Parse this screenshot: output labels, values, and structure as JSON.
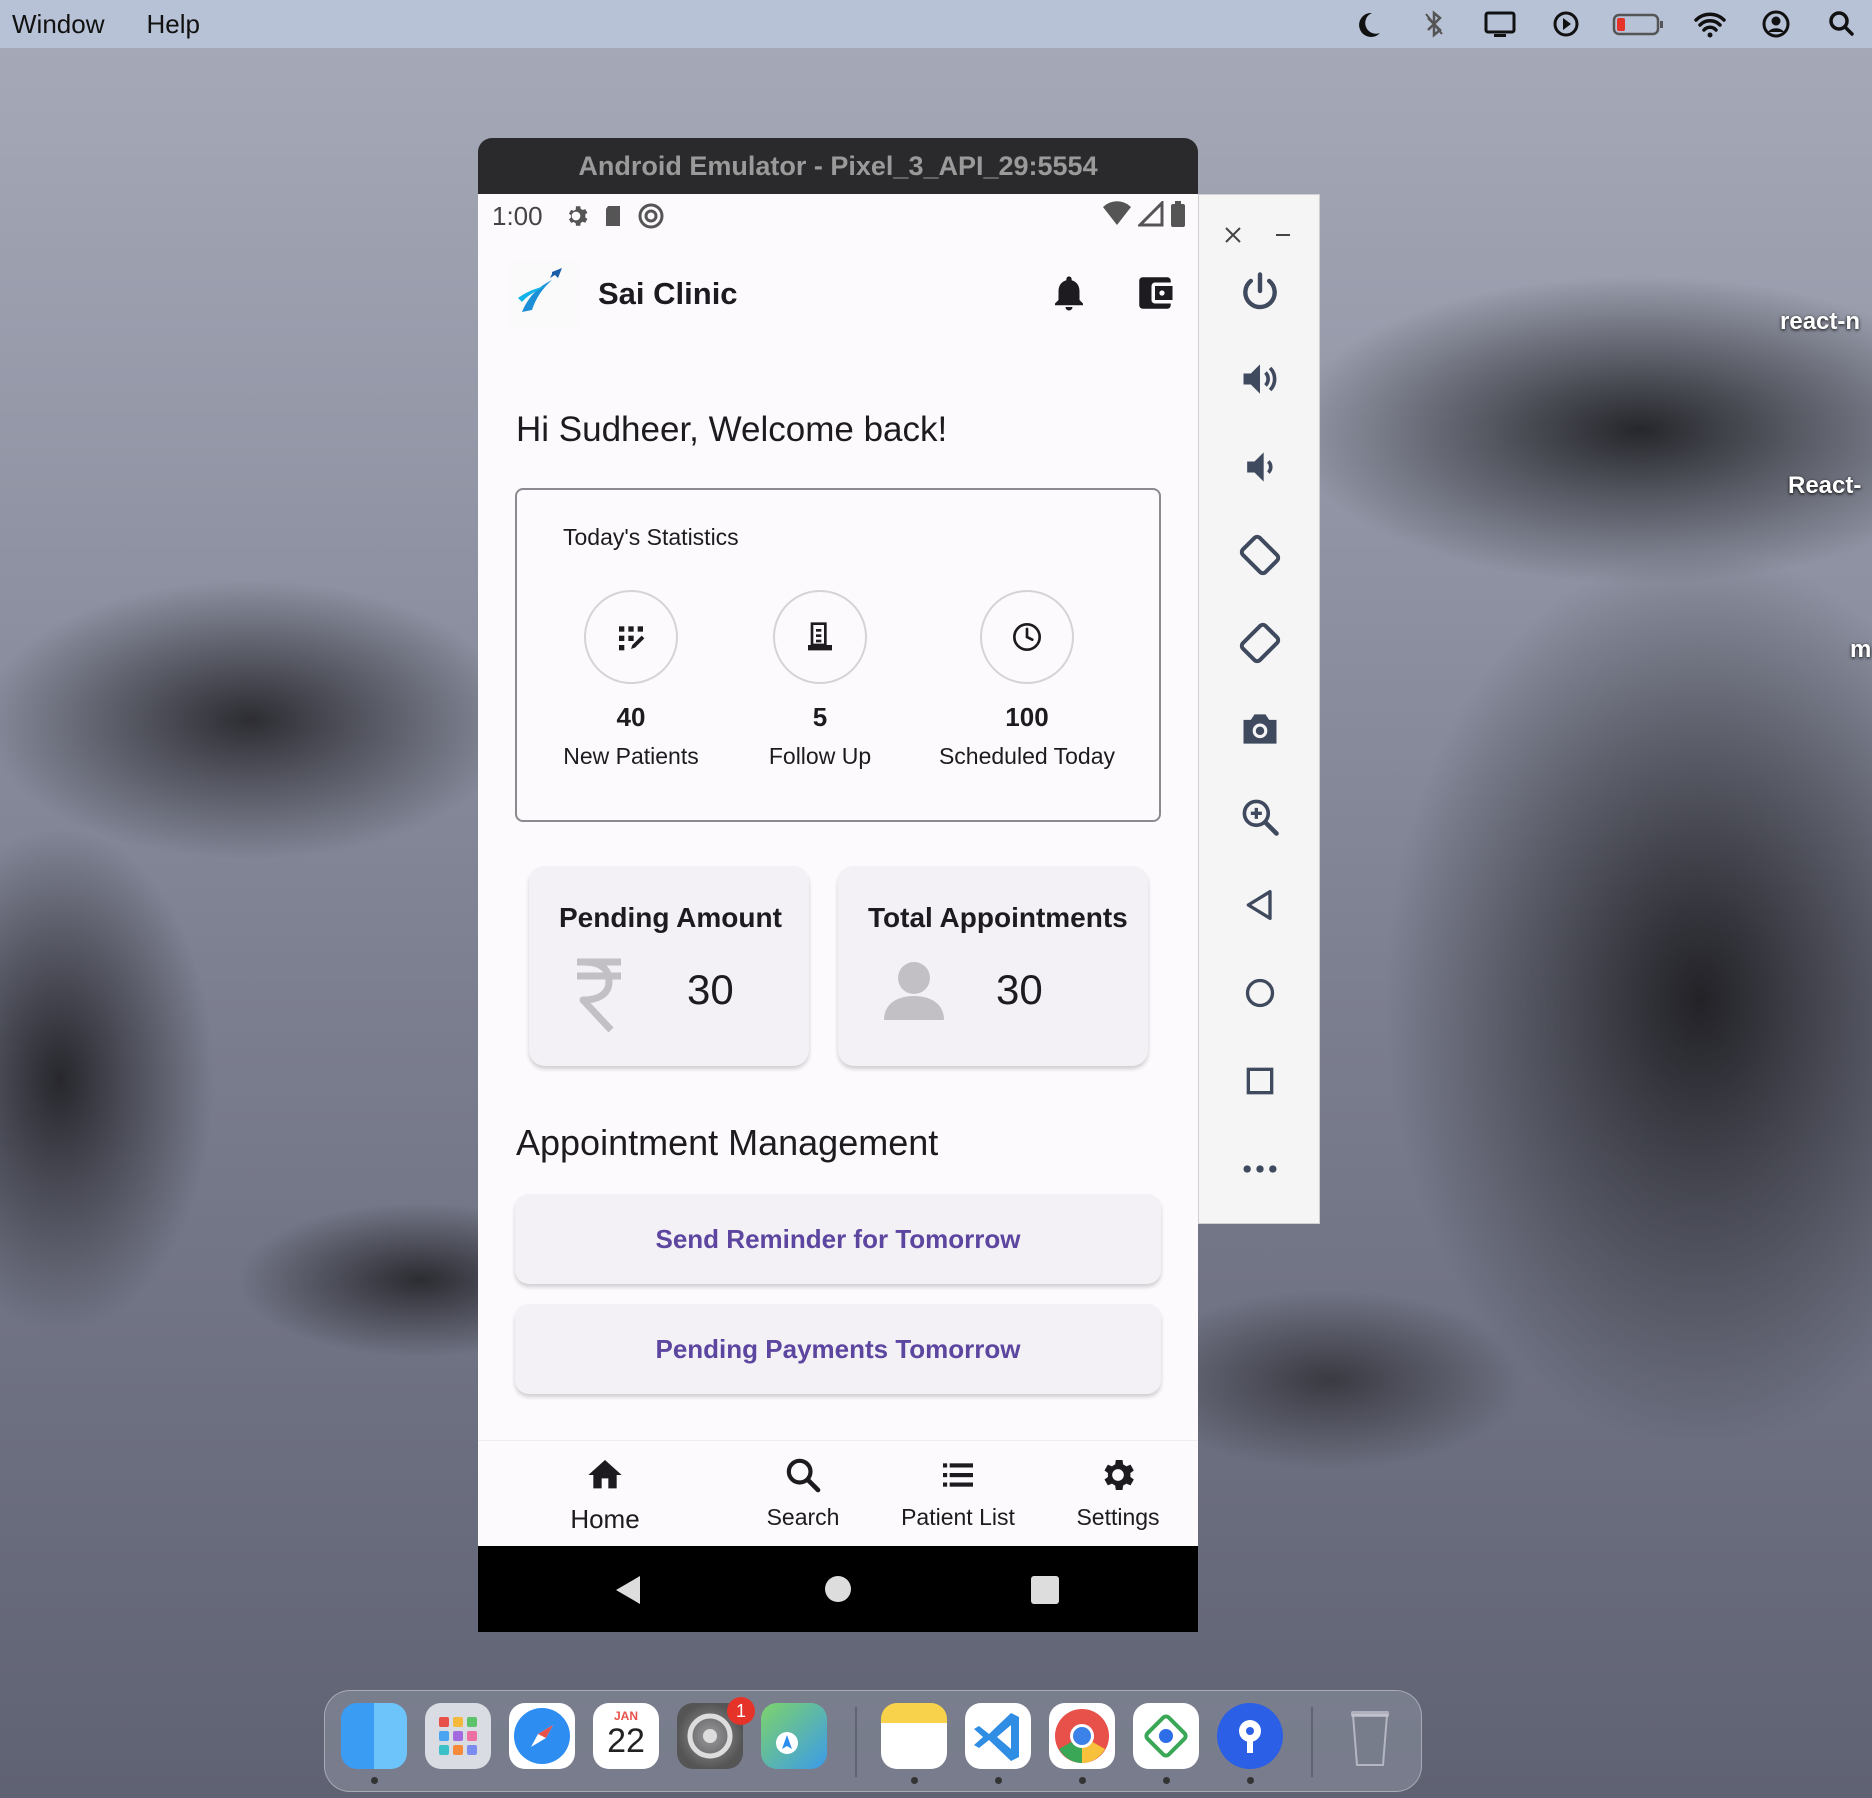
{
  "menubar": {
    "items": [
      "Window",
      "Help"
    ]
  },
  "desktop": {
    "labels": [
      "react-n",
      "React-",
      "m"
    ]
  },
  "emulator": {
    "title": "Android Emulator - Pixel_3_API_29:5554",
    "status_time": "1:00"
  },
  "app": {
    "name": "Sai Clinic",
    "welcome": "Hi Sudheer, Welcome back!",
    "stats": {
      "title": "Today's Statistics",
      "items": [
        {
          "value": "40",
          "label": "New Patients"
        },
        {
          "value": "5",
          "label": "Follow Up"
        },
        {
          "value": "100",
          "label": "Scheduled Today"
        }
      ]
    },
    "cards": [
      {
        "title": "Pending Amount",
        "value": "30",
        "icon": "rupee-icon"
      },
      {
        "title": "Total Appointments",
        "value": "30",
        "icon": "person-icon"
      }
    ],
    "section_title": "Appointment Management",
    "actions": [
      "Send Reminder for Tomorrow",
      "Pending Payments Tomorrow"
    ],
    "nav": [
      "Home",
      "Search",
      "Patient List",
      "Settings"
    ]
  },
  "dock": {
    "calendar_month": "JAN",
    "calendar_day": "22",
    "badge": "1"
  },
  "colors": {
    "accent": "#5c46a0",
    "surface": "#fdfafd",
    "card": "#f4f1f6"
  }
}
